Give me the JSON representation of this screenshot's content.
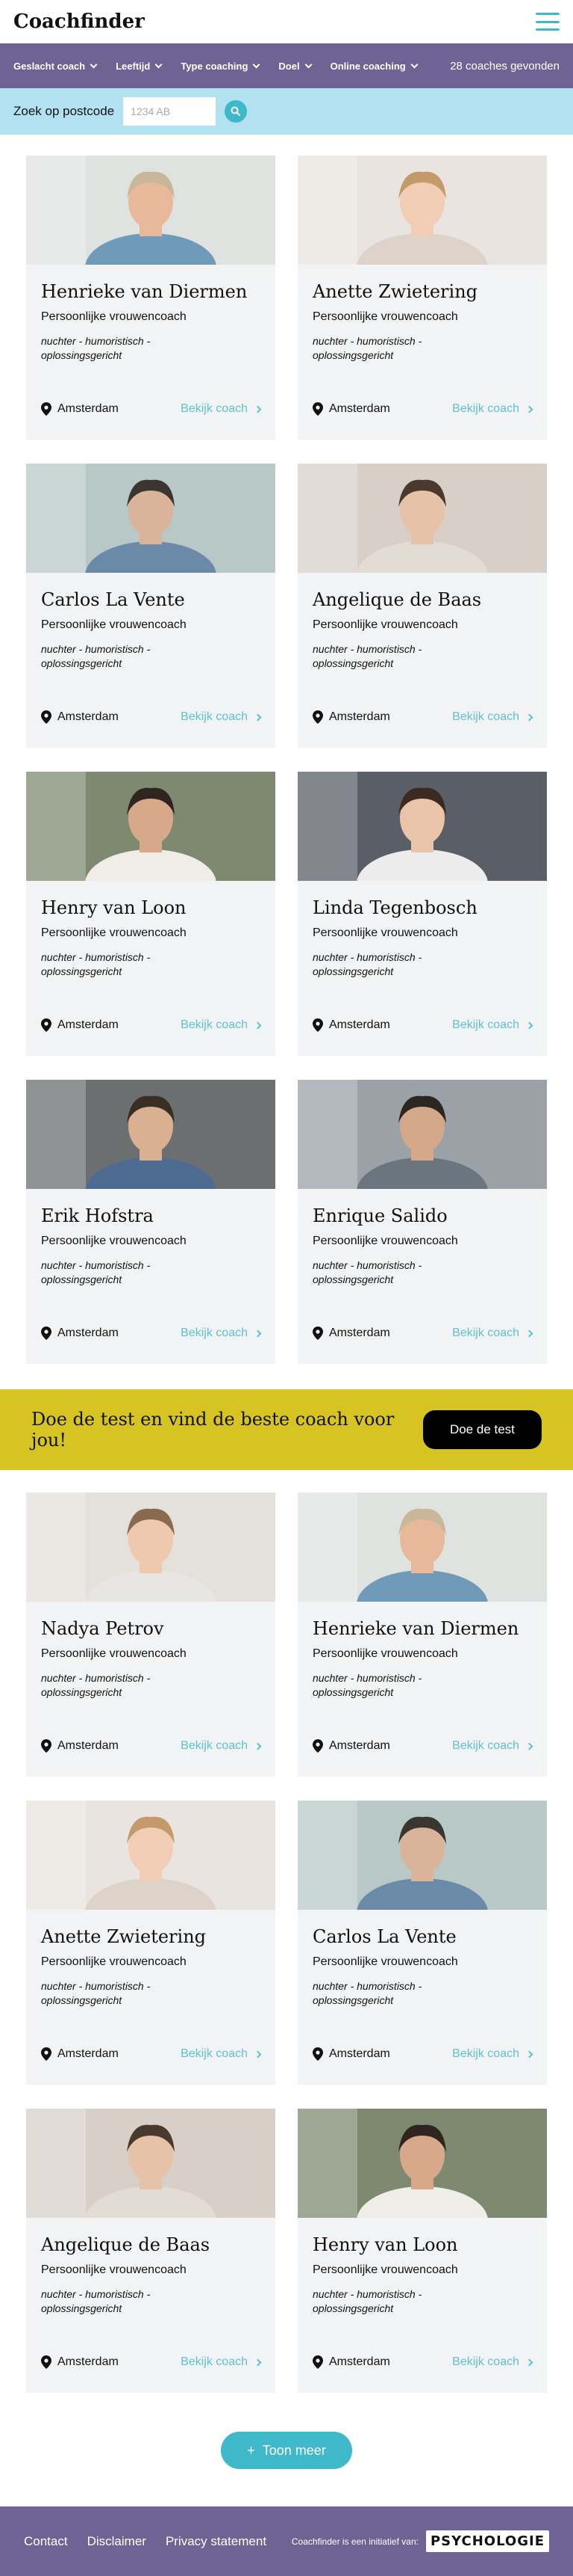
{
  "header": {
    "logo": "Coachfinder"
  },
  "filters": {
    "items": [
      "Geslacht coach",
      "Leeftijd",
      "Type coaching",
      "Doel",
      "Online coaching"
    ],
    "count_text": "28 coaches gevonden"
  },
  "postcode": {
    "label": "Zoek op postcode",
    "placeholder": "1234 AB"
  },
  "coaches_top": [
    {
      "name": "Henrieke van Diermen",
      "type": "Persoonlijke vrouwencoach",
      "tags": "nuchter - humoristisch - oplossingsgericht",
      "location": "Amsterdam",
      "link": "Bekijk coach"
    },
    {
      "name": "Anette Zwietering",
      "type": "Persoonlijke vrouwencoach",
      "tags": "nuchter - humoristisch - oplossingsgericht",
      "location": "Amsterdam",
      "link": "Bekijk coach"
    },
    {
      "name": "Carlos La Vente",
      "type": "Persoonlijke vrouwencoach",
      "tags": "nuchter - humoristisch - oplossingsgericht",
      "location": "Amsterdam",
      "link": "Bekijk coach"
    },
    {
      "name": "Angelique de Baas",
      "type": "Persoonlijke vrouwencoach",
      "tags": "nuchter - humoristisch - oplossingsgericht",
      "location": "Amsterdam",
      "link": "Bekijk coach"
    },
    {
      "name": "Henry van Loon",
      "type": "Persoonlijke vrouwencoach",
      "tags": "nuchter - humoristisch - oplossingsgericht",
      "location": "Amsterdam",
      "link": "Bekijk coach"
    },
    {
      "name": "Linda Tegenbosch",
      "type": "Persoonlijke vrouwencoach",
      "tags": "nuchter - humoristisch - oplossingsgericht",
      "location": "Amsterdam",
      "link": "Bekijk coach"
    },
    {
      "name": "Erik  Hofstra",
      "type": "Persoonlijke vrouwencoach",
      "tags": "nuchter - humoristisch - oplossingsgericht",
      "location": "Amsterdam",
      "link": "Bekijk coach"
    },
    {
      "name": "Enrique Salido",
      "type": "Persoonlijke vrouwencoach",
      "tags": "nuchter - humoristisch - oplossingsgericht",
      "location": "Amsterdam",
      "link": "Bekijk coach"
    }
  ],
  "banner": {
    "text": "Doe de test en vind de beste coach voor jou!",
    "button": "Doe de test"
  },
  "coaches_bottom": [
    {
      "name": "Nadya Petrov",
      "type": "Persoonlijke vrouwencoach",
      "tags": "nuchter - humoristisch - oplossingsgericht",
      "location": "Amsterdam",
      "link": "Bekijk coach"
    },
    {
      "name": "Henrieke van Diermen",
      "type": "Persoonlijke vrouwencoach",
      "tags": "nuchter - humoristisch - oplossingsgericht",
      "location": "Amsterdam",
      "link": "Bekijk coach"
    },
    {
      "name": "Anette Zwietering",
      "type": "Persoonlijke vrouwencoach",
      "tags": "nuchter - humoristisch - oplossingsgericht",
      "location": "Amsterdam",
      "link": "Bekijk coach"
    },
    {
      "name": "Carlos La Vente",
      "type": "Persoonlijke vrouwencoach",
      "tags": "nuchter - humoristisch - oplossingsgericht",
      "location": "Amsterdam",
      "link": "Bekijk coach"
    },
    {
      "name": "Angelique de Baas",
      "type": "Persoonlijke vrouwencoach",
      "tags": "nuchter - humoristisch - oplossingsgericht",
      "location": "Amsterdam",
      "link": "Bekijk coach"
    },
    {
      "name": "Henry van Loon",
      "type": "Persoonlijke vrouwencoach",
      "tags": "nuchter - humoristisch - oplossingsgericht",
      "location": "Amsterdam",
      "link": "Bekijk coach"
    }
  ],
  "load_more": {
    "label": "Toon meer",
    "icon": "plus-icon"
  },
  "footer": {
    "links": [
      "Contact",
      "Disclaimer",
      "Privacy statement"
    ],
    "initiative": "Coachfinder is een initiatief van:",
    "brand": "PSYCHOLOGIE"
  },
  "colors": {
    "accent": "#3fb8c9",
    "purple": "#6f6394",
    "lightblue": "#b2e1f2",
    "yellow": "#d6c422",
    "card_bg": "#f2f3f4"
  }
}
